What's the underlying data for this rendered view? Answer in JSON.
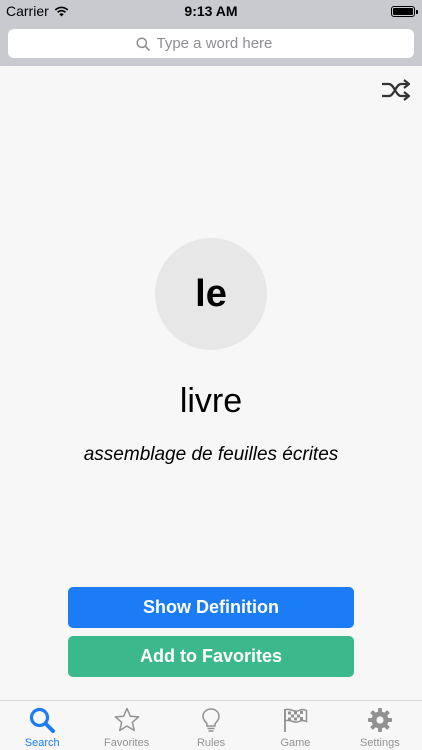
{
  "status_bar": {
    "carrier": "Carrier",
    "time": "9:13 AM"
  },
  "search": {
    "placeholder": "Type a word here"
  },
  "card": {
    "article": "le",
    "word": "livre",
    "definition": "assemblage de feuilles écrites"
  },
  "buttons": {
    "show_definition": "Show Definition",
    "add_to_favorites": "Add to Favorites"
  },
  "tabs": [
    {
      "label": "Search",
      "icon": "search-icon",
      "active": true
    },
    {
      "label": "Favorites",
      "icon": "star-icon",
      "active": false
    },
    {
      "label": "Rules",
      "icon": "lightbulb-icon",
      "active": false
    },
    {
      "label": "Game",
      "icon": "flag-icon",
      "active": false
    },
    {
      "label": "Settings",
      "icon": "gear-icon",
      "active": false
    }
  ],
  "colors": {
    "accent": "#1b7cf5",
    "favorites_button": "#3bb98c",
    "inactive_tab": "#929292"
  }
}
